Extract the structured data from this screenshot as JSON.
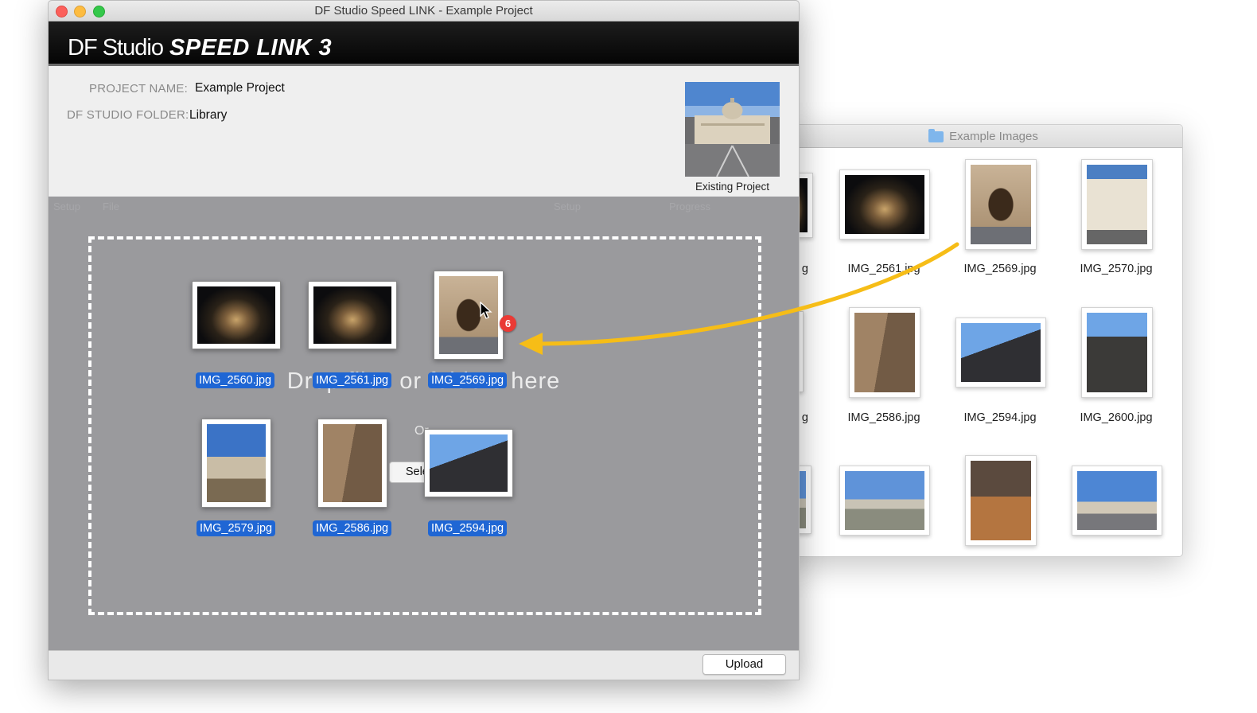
{
  "window": {
    "title": "DF Studio Speed LINK - Example Project",
    "logo_part1": "DF Studio",
    "logo_part2": "SPEED LINK 3"
  },
  "project": {
    "name_label": "PROJECT NAME:",
    "name_value": "Example Project",
    "folder_label": "DF STUDIO FOLDER:",
    "folder_value": "Library",
    "thumbnail_label": "Existing Project"
  },
  "table_headers": [
    "Setup",
    "File",
    "Setup",
    "Progress"
  ],
  "drop_zone": {
    "text": "Drop files or folders here",
    "or_text": "Or",
    "select_label": "Select"
  },
  "dragged_items": [
    {
      "name": "IMG_2560.jpg",
      "icon": "night-monument-photo"
    },
    {
      "name": "IMG_2561.jpg",
      "icon": "night-monument-photo"
    },
    {
      "name": "IMG_2569.jpg",
      "icon": "doorway-photo"
    },
    {
      "name": "IMG_2579.jpg",
      "icon": "piazza-photo"
    },
    {
      "name": "IMG_2586.jpg",
      "icon": "ruins-photo"
    },
    {
      "name": "IMG_2594.jpg",
      "icon": "pantheon-photo"
    }
  ],
  "drag_count": "6",
  "footer": {
    "upload_label": "Upload"
  },
  "finder": {
    "title": "Example Images",
    "items": [
      {
        "name": "IMG_2561.jpg"
      },
      {
        "name": "IMG_2569.jpg"
      },
      {
        "name": "IMG_2570.jpg"
      },
      {
        "name": "IMG_2586.jpg"
      },
      {
        "name": "IMG_2594.jpg"
      },
      {
        "name": "IMG_2600.jpg"
      },
      {
        "name": ""
      },
      {
        "name": ""
      },
      {
        "name": ""
      }
    ],
    "partial_labels": [
      "g",
      "g"
    ]
  },
  "colors": {
    "selection_blue": "#1f66d4",
    "arrow_yellow": "#f6bd17",
    "badge_red": "#ea3a35"
  }
}
